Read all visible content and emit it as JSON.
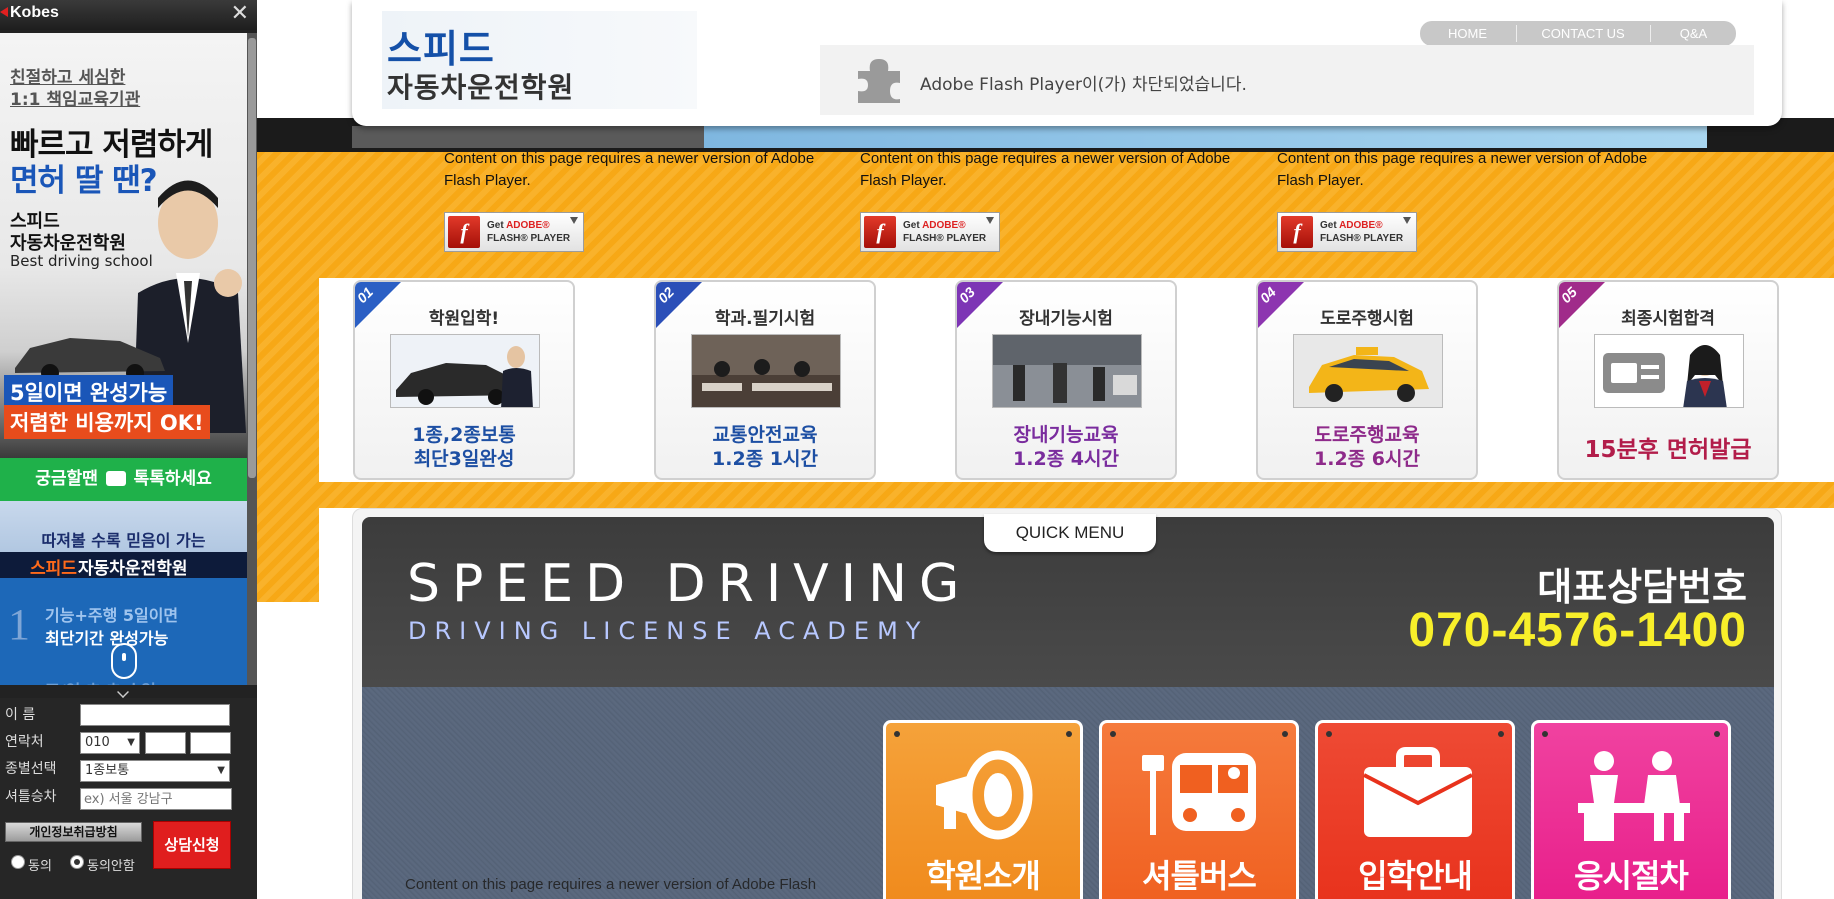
{
  "sidebar": {
    "logo": "Kobes",
    "close_icon": "close-icon",
    "ad": {
      "line1": "친절하고 세심한",
      "line2": "1:1 책임교육기관",
      "headline1": "빠르고 저렴하게",
      "headline2": "면허 딸 땐?",
      "school1": "스피드",
      "school2": "자동차운전학원",
      "school3": "Best driving school",
      "badge1": "5일이면 완성가능",
      "badge2": "저렴한 비용까지 OK!"
    },
    "kakao": {
      "pre": "궁금할땐",
      "post": "톡톡하세요"
    },
    "banner": {
      "line1": "따져볼 수록 믿음이 가는",
      "line2a": "스피드",
      "line2b": "자동차운전학원",
      "num": "1",
      "line3": "기능+주행 5일이면",
      "line4": "최단기간 완성가능",
      "line5": "조/연 초 초 수업"
    },
    "form": {
      "name_label": "이 름",
      "contact_label": "연락처",
      "phone_prefix": "010",
      "type_label": "종별선택",
      "type_value": "1종보통",
      "shuttle_label": "셔틀승차",
      "shuttle_placeholder": "ex) 서울 강남구",
      "privacy_button": "개인정보취급방침",
      "apply_button": "상담신청",
      "agree": "동의",
      "disagree": "동의안함"
    }
  },
  "header": {
    "logo_line1": "스피드",
    "logo_line2": "자동차운전학원",
    "nav": [
      "HOME",
      "CONTACT US",
      "Q&A"
    ],
    "flash_blocked": "Adobe Flash Player이(가) 차단되었습니다."
  },
  "flash": {
    "message": "Content on this page requires a newer version of Adobe Flash Player.",
    "button_line1_pre": "Get ",
    "button_line1_brand": "ADOBE®",
    "button_line2": "FLASH® PLAYER"
  },
  "steps": [
    {
      "num": "01",
      "title": "학원입학!",
      "desc1": "1종,2종보통",
      "desc2": "최단3일완성",
      "color": "#1d4fa3",
      "num_color": "#2b5fc4"
    },
    {
      "num": "02",
      "title": "학과.필기시험",
      "desc1": "교통안전교육",
      "desc2": "1.2종 1시간",
      "color": "#1d4fa3",
      "num_color": "#2b4fb8"
    },
    {
      "num": "03",
      "title": "장내기능시험",
      "desc1": "장내기능교육",
      "desc2": "1.2종 4시간",
      "color": "#7a2c9e",
      "num_color": "#7d35b5"
    },
    {
      "num": "04",
      "title": "도로주행시험",
      "desc1": "도로주행교육",
      "desc2": "1.2종 6시간",
      "color": "#8e2a8a",
      "num_color": "#8d35b0"
    },
    {
      "num": "05",
      "title": "최종시험합격",
      "desc1": "15분후 면허발급",
      "desc2": "",
      "color": "#b21d4a",
      "num_color": "#a02b8a"
    }
  ],
  "quick": {
    "tab": "QUICK MENU",
    "title": "SPEED DRIVING",
    "subtitle": "DRIVING LICENSE ACADEMY",
    "rep_label": "대표상담번호",
    "rep_phone": "070-4576-1400",
    "buttons": [
      {
        "label": "학원소개",
        "icon": "megaphone-icon",
        "color": "#f08a1c"
      },
      {
        "label": "셔틀버스",
        "icon": "bus-icon",
        "color": "#f06020"
      },
      {
        "label": "입학안내",
        "icon": "briefcase-icon",
        "color": "#e8321c"
      },
      {
        "label": "응시절차",
        "icon": "reception-icon",
        "color": "#e81e8a"
      }
    ],
    "bottom_flash_text": "Content on this page requires a newer version of Adobe Flash"
  }
}
